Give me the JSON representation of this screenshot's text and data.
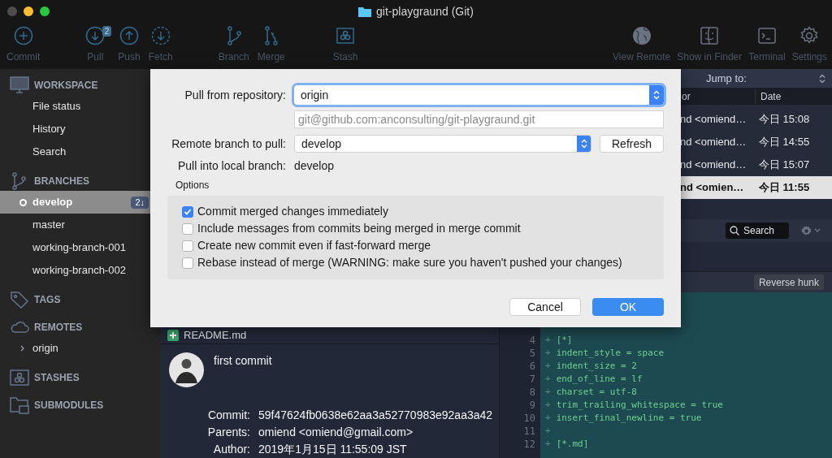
{
  "window": {
    "title": "git-playgraund (Git)"
  },
  "toolbar": {
    "left": [
      {
        "label": "Commit",
        "kind": "commit"
      },
      {
        "label": "Pull",
        "kind": "pull",
        "badge": "2"
      },
      {
        "label": "Push",
        "kind": "push"
      },
      {
        "label": "Fetch",
        "kind": "fetch"
      },
      {
        "label": "Branch",
        "kind": "branch"
      },
      {
        "label": "Merge",
        "kind": "merge"
      },
      {
        "label": "Stash",
        "kind": "stash"
      }
    ],
    "right": [
      {
        "label": "View Remote",
        "kind": "globe"
      },
      {
        "label": "Show in Finder",
        "kind": "finder"
      },
      {
        "label": "Terminal",
        "kind": "terminal"
      },
      {
        "label": "Settings",
        "kind": "settings"
      }
    ]
  },
  "sidebar": {
    "sections": [
      {
        "title": "WORKSPACE",
        "kind": "workspace",
        "items": [
          {
            "label": "File status",
            "selected": false
          },
          {
            "label": "History",
            "selected": false
          },
          {
            "label": "Search",
            "selected": false
          }
        ]
      },
      {
        "title": "BRANCHES",
        "kind": "branches",
        "items": [
          {
            "label": "develop",
            "selected": true,
            "current": true,
            "badge": "2↓"
          },
          {
            "label": "master",
            "selected": false,
            "current": false
          },
          {
            "label": "working-branch-001",
            "selected": false,
            "current": false
          },
          {
            "label": "working-branch-002",
            "selected": false,
            "current": false
          }
        ]
      },
      {
        "title": "TAGS",
        "kind": "tags"
      },
      {
        "title": "REMOTES",
        "kind": "remotes",
        "items": [
          {
            "label": "origin",
            "selected": false,
            "expanded": false
          }
        ]
      },
      {
        "title": "STASHES",
        "kind": "stashes"
      },
      {
        "title": "SUBMODULES",
        "kind": "submodules"
      }
    ]
  },
  "history": {
    "jump_label": "Jump to:",
    "columns": [
      "or",
      "Date"
    ],
    "rows": [
      {
        "author": "nd <omiend…",
        "date": "今日 15:08",
        "selected": false
      },
      {
        "author": "nd <omiend…",
        "date": "今日 14:55",
        "selected": false
      },
      {
        "author": "nd <omiend…",
        "date": "今日 15:07",
        "selected": false
      },
      {
        "author": "nd <omien…",
        "date": "今日 11:55",
        "selected": true
      }
    ]
  },
  "diff_toolbar": {
    "search": {
      "placeholder": "Search"
    }
  },
  "files": [
    {
      "name": "README.md",
      "kind": "added"
    }
  ],
  "commit": {
    "subject": "first commit",
    "fields": [
      {
        "label": "Commit:",
        "value": "59f47624fb0638e62aa3a52770983e92aa3a42"
      },
      {
        "label": "Parents:",
        "value": "omiend <omiend@gmail.com>"
      },
      {
        "label": "Author:",
        "value": "2019年1月15日 11:55:09 JST"
      }
    ]
  },
  "diff": {
    "hunk_button": "Reverse hunk",
    "lines": [
      {
        "number": "4",
        "sign": "+",
        "text": "[*]",
        "kind": "added"
      },
      {
        "number": "5",
        "sign": "+",
        "text": "indent_style = space",
        "kind": "added"
      },
      {
        "number": "6",
        "sign": "+",
        "text": "indent_size = 2",
        "kind": "added"
      },
      {
        "number": "7",
        "sign": "+",
        "text": "end_of_line = lf",
        "kind": "added"
      },
      {
        "number": "8",
        "sign": "+",
        "text": "charset = utf-8",
        "kind": "added"
      },
      {
        "number": "9",
        "sign": "+",
        "text": "trim_trailing_whitespace = true",
        "kind": "added"
      },
      {
        "number": "10",
        "sign": "+",
        "text": "insert_final_newline = true",
        "kind": "added"
      },
      {
        "number": "11",
        "sign": "+",
        "kind": "added"
      },
      {
        "number": "12",
        "sign": "+",
        "text": "[*.md]",
        "kind": "added"
      }
    ]
  },
  "dialog": {
    "repository_label": "Pull from repository:",
    "repository": "origin",
    "url": "git@github.com:anconsulting/git-playgraund.git",
    "branch_label": "Remote branch to pull:",
    "branch": "develop",
    "refresh": "Refresh",
    "local_label": "Pull into local branch:",
    "local_branch": "develop",
    "options_label": "Options",
    "options": [
      {
        "label": "Commit merged changes immediately",
        "checked": true
      },
      {
        "label": "Include messages from commits being merged in merge commit",
        "checked": false
      },
      {
        "label": "Create new commit even if fast-forward merge",
        "checked": false
      },
      {
        "label": "Rebase instead of merge (WARNING: make sure you haven't pushed your changes)",
        "checked": false
      }
    ],
    "buttons": [
      {
        "label": "Cancel",
        "kind": "cancel"
      },
      {
        "label": "OK",
        "kind": "default"
      }
    ]
  }
}
